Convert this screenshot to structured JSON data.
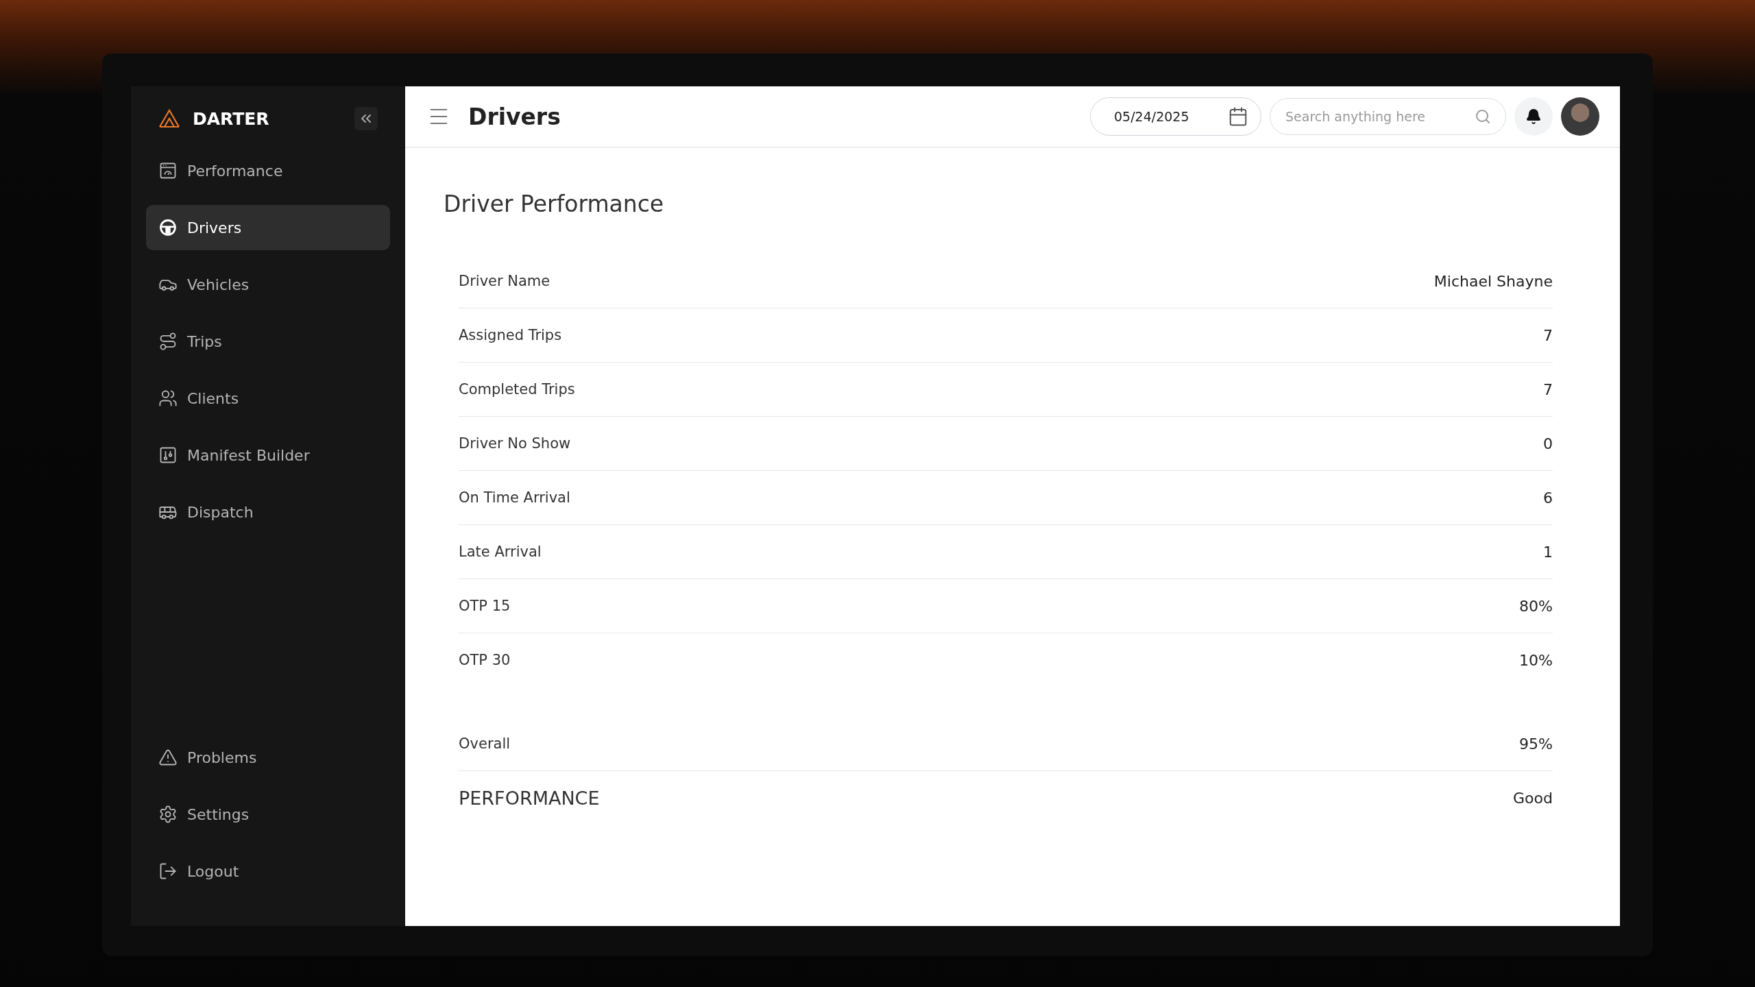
{
  "brand": {
    "name": "DARTER"
  },
  "sidebar": {
    "items": [
      {
        "label": "Performance",
        "selected": false
      },
      {
        "label": "Drivers",
        "selected": true
      },
      {
        "label": "Vehicles",
        "selected": false
      },
      {
        "label": "Trips",
        "selected": false
      },
      {
        "label": "Clients",
        "selected": false
      },
      {
        "label": "Manifest Builder",
        "selected": false
      },
      {
        "label": "Dispatch",
        "selected": false
      }
    ],
    "bottom_items": [
      {
        "label": "Problems"
      },
      {
        "label": "Settings"
      },
      {
        "label": "Logout"
      }
    ]
  },
  "header": {
    "title": "Drivers",
    "date": "05/24/2025",
    "search": {
      "placeholder": "Search anything here"
    }
  },
  "card": {
    "title": "Driver Performance",
    "rows": [
      {
        "kind": "metric",
        "label": "Driver Name",
        "value": "Michael Shayne"
      },
      {
        "kind": "metric",
        "label": "Assigned Trips",
        "value": "7"
      },
      {
        "kind": "metric",
        "label": "Completed Trips",
        "value": "7"
      },
      {
        "kind": "metric",
        "label": "Driver No Show",
        "value": "0"
      },
      {
        "kind": "metric",
        "label": "On Time Arrival",
        "value": "6"
      },
      {
        "kind": "metric",
        "label": "Late Arrival",
        "value": "1"
      },
      {
        "kind": "metric",
        "label": "OTP 15",
        "value": "80%"
      },
      {
        "kind": "metric",
        "label": "OTP 30",
        "value": "10%"
      },
      {
        "kind": "total",
        "label": "Overall",
        "value": "95%"
      },
      {
        "kind": "rating",
        "label": "PERFORMANCE",
        "value": "Good"
      }
    ]
  }
}
